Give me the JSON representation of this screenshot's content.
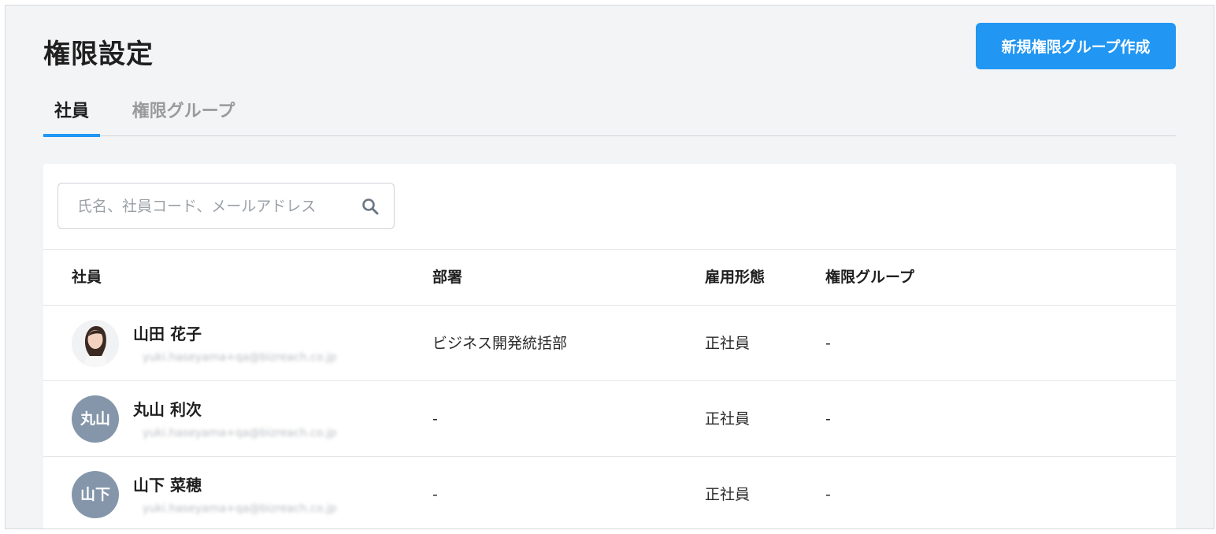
{
  "header": {
    "title": "権限設定",
    "create_button_label": "新規権限グループ作成"
  },
  "tabs": [
    {
      "label": "社員",
      "active": true
    },
    {
      "label": "権限グループ",
      "active": false
    }
  ],
  "search": {
    "placeholder": "氏名、社員コード、メールアドレス",
    "icon": "search-icon"
  },
  "table": {
    "columns": [
      "社員",
      "部署",
      "雇用形態",
      "権限グループ"
    ],
    "rows": [
      {
        "avatar": "photo",
        "avatar_text": "",
        "name": "山田 花子",
        "email": "yuki.haseyama+qa@bizreach.co.jp",
        "department": "ビジネス開発統括部",
        "employment_type": "正社員",
        "permission_group": "-"
      },
      {
        "avatar": "initials",
        "avatar_text": "丸山",
        "name": "丸山 利次",
        "email": "yuki.haseyama+qa@bizreach.co.jp",
        "department": "-",
        "employment_type": "正社員",
        "permission_group": "-"
      },
      {
        "avatar": "initials",
        "avatar_text": "山下",
        "name": "山下 菜穂",
        "email": "yuki.haseyama+qa@bizreach.co.jp",
        "department": "-",
        "employment_type": "正社員",
        "permission_group": "-"
      }
    ]
  },
  "colors": {
    "accent": "#2196f3",
    "avatar_bg": "#8596aa",
    "page_bg": "#f3f4f6"
  }
}
